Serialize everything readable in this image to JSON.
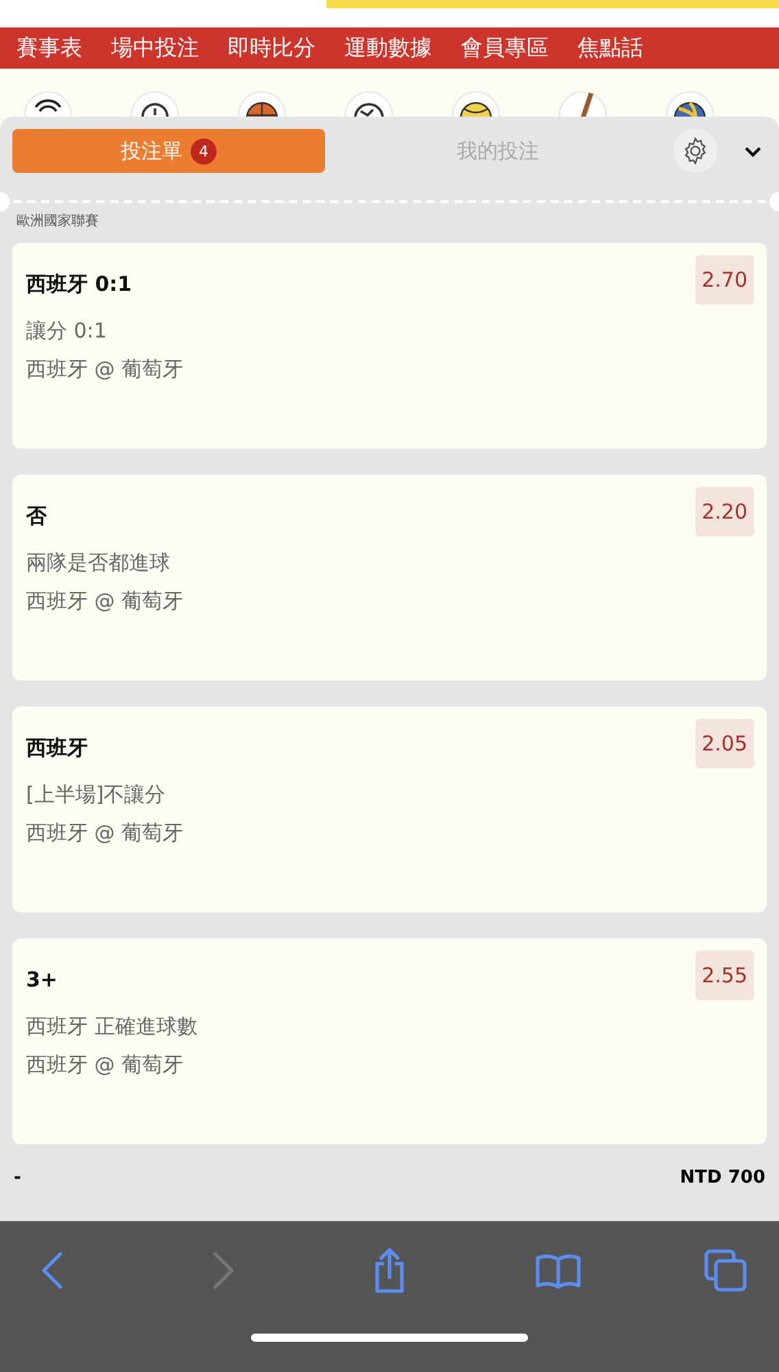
{
  "nav": [
    {
      "label": "賽事表"
    },
    {
      "label": "場中投注"
    },
    {
      "label": "即時比分"
    },
    {
      "label": "運動數據"
    },
    {
      "label": "會員專區"
    },
    {
      "label": "焦點話"
    }
  ],
  "sports": [
    {
      "kind": "signal"
    },
    {
      "kind": "stopwatch"
    },
    {
      "kind": "basketball"
    },
    {
      "kind": "soccer"
    },
    {
      "kind": "tennis"
    },
    {
      "kind": "bat"
    },
    {
      "kind": "volleyball"
    }
  ],
  "tabs": [
    {
      "label": "投注單",
      "badge": "4",
      "selected": true
    },
    {
      "label": "我的投注",
      "selected": false
    }
  ],
  "league": "歐洲國家聯賽",
  "bets": [
    {
      "selection": "西班牙 0:1",
      "market": "讓分 0:1",
      "match": "西班牙 @ 葡萄牙",
      "odds": "2.70"
    },
    {
      "selection": "否",
      "market": "兩隊是否都進球",
      "match": "西班牙 @ 葡萄牙",
      "odds": "2.20"
    },
    {
      "selection": "西班牙",
      "market": "[上半場]不讓分",
      "match": "西班牙 @ 葡萄牙",
      "odds": "2.05"
    },
    {
      "selection": "3+",
      "market": "西班牙 正確進球數",
      "match": "西班牙 @ 葡萄牙",
      "odds": "2.55"
    }
  ],
  "summary": {
    "left": "-",
    "total": "NTD 700"
  },
  "toolbar": [
    {
      "kind": "back",
      "disabled": false
    },
    {
      "kind": "forward",
      "disabled": true
    },
    {
      "kind": "share",
      "disabled": false
    },
    {
      "kind": "bookmarks",
      "disabled": false
    },
    {
      "kind": "tabs",
      "disabled": false
    }
  ]
}
